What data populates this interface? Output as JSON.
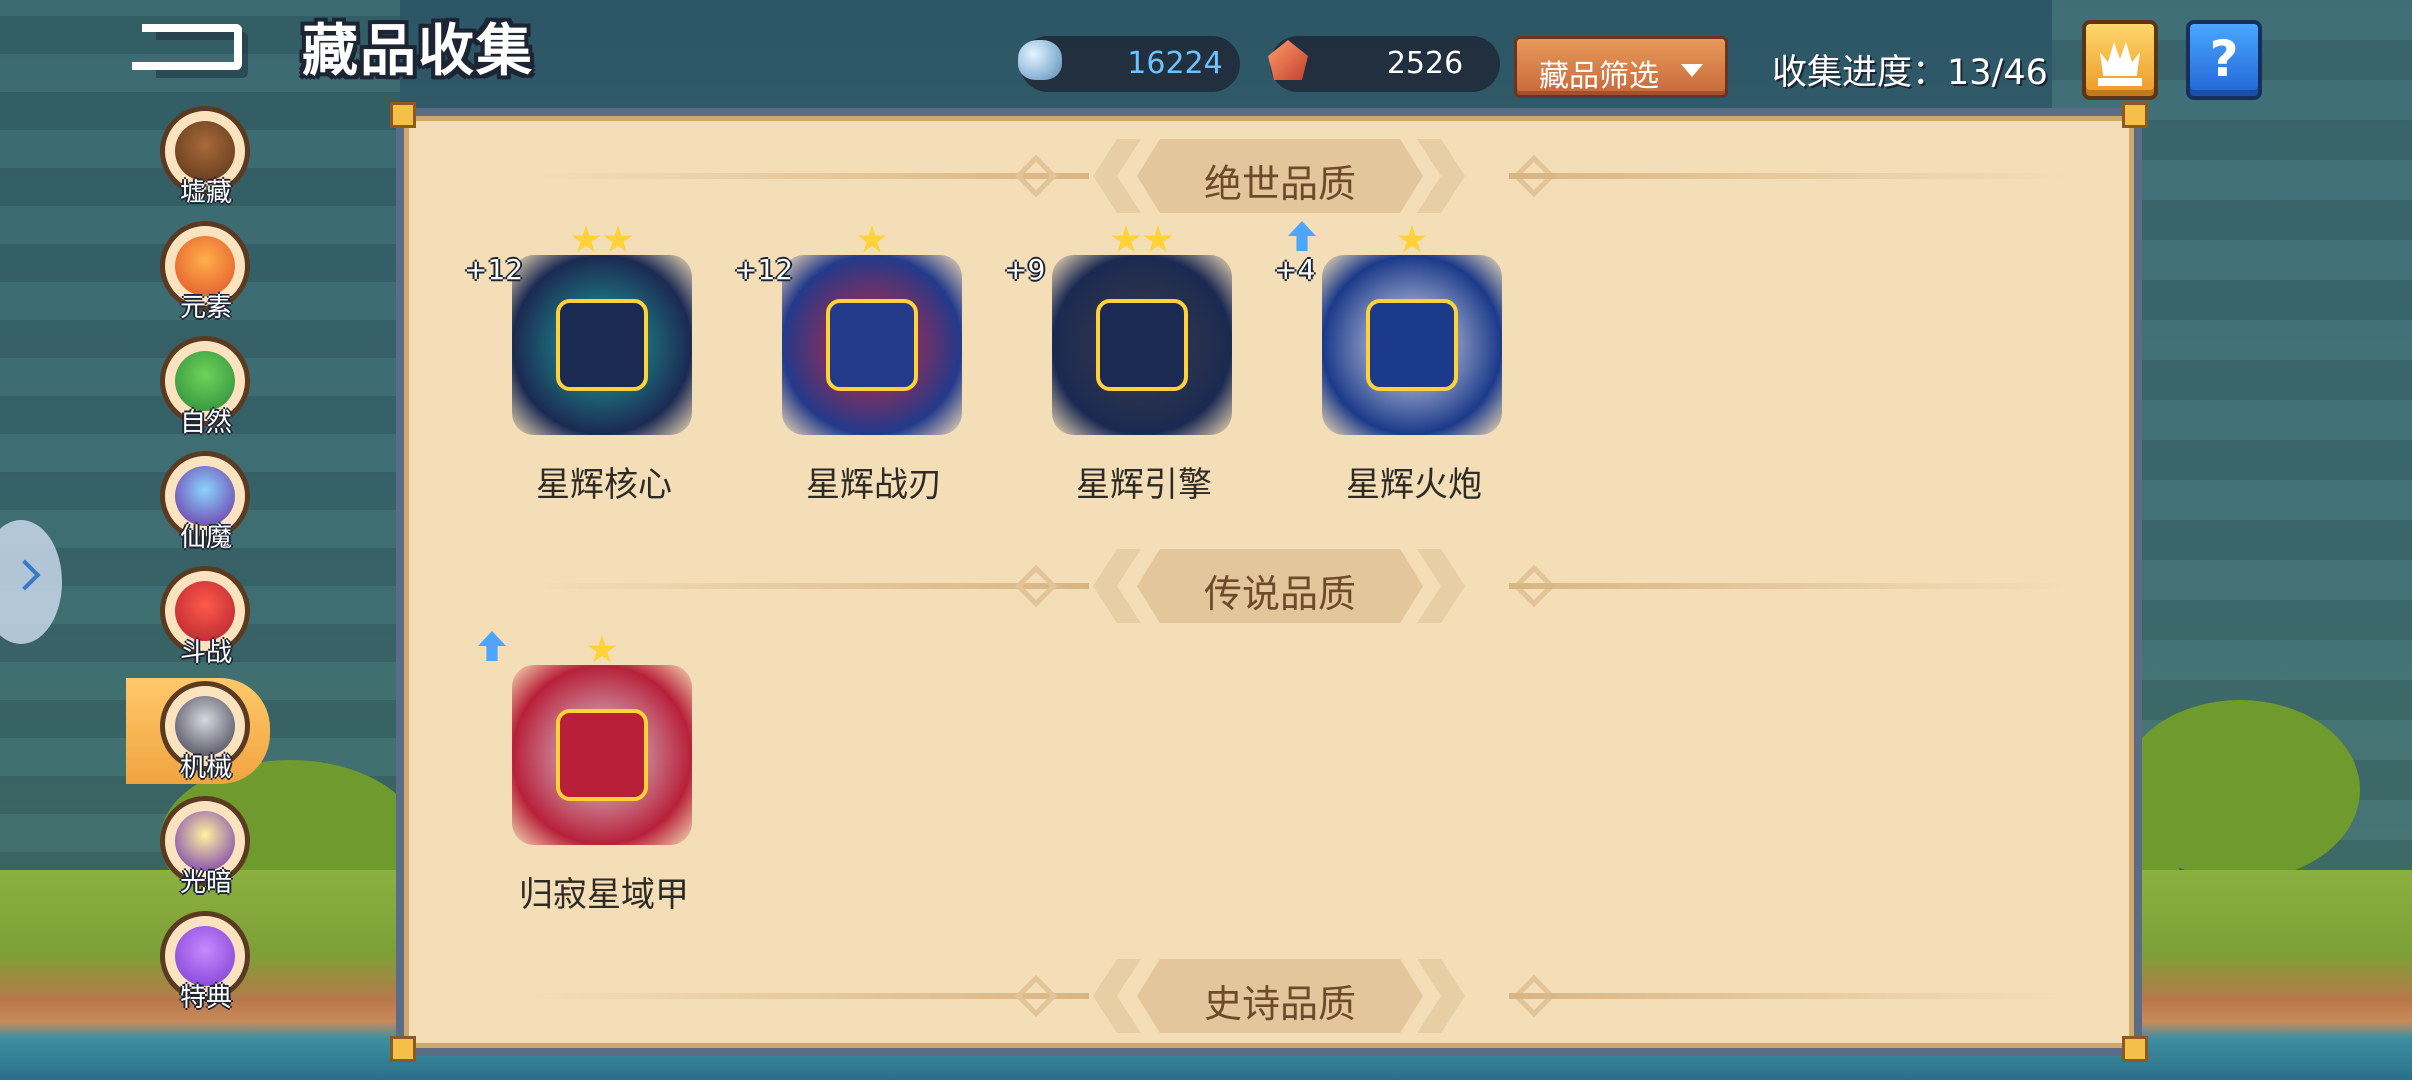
{
  "header": {
    "title": "藏品收集",
    "gems": "16224",
    "crystals": "2526",
    "filter_label": "藏品筛选",
    "progress": "收集进度：13/46"
  },
  "sidebar": {
    "items": [
      {
        "label": "墟藏",
        "icon": "treasure-chest-icon"
      },
      {
        "label": "元素",
        "icon": "fire-orb-icon"
      },
      {
        "label": "自然",
        "icon": "tree-icon"
      },
      {
        "label": "仙魔",
        "icon": "demon-crystal-icon"
      },
      {
        "label": "斗战",
        "icon": "battle-orb-icon"
      },
      {
        "label": "机械",
        "icon": "mech-armor-icon"
      },
      {
        "label": "光暗",
        "icon": "light-dark-icon"
      },
      {
        "label": "特典",
        "icon": "special-star-icon"
      }
    ],
    "active_index": 5
  },
  "sections": [
    {
      "title": "绝世品质",
      "items": [
        {
          "name": "星辉核心",
          "level": "+12",
          "stars": 2,
          "upgradable": false,
          "colors": [
            "#1fa89e",
            "#1b2a52"
          ]
        },
        {
          "name": "星辉战刃",
          "level": "+12",
          "stars": 1,
          "upgradable": false,
          "colors": [
            "#d0253a",
            "#233a8a"
          ]
        },
        {
          "name": "星辉引擎",
          "level": "+9",
          "stars": 2,
          "upgradable": false,
          "colors": [
            "#3a3a46",
            "#1b2a52"
          ]
        },
        {
          "name": "星辉火炮",
          "level": "+4",
          "stars": 1,
          "upgradable": true,
          "colors": [
            "#e8e8f2",
            "#1b3a8a"
          ]
        }
      ]
    },
    {
      "title": "传说品质",
      "items": [
        {
          "name": "归寂星域甲",
          "level": "",
          "stars": 1,
          "upgradable": true,
          "colors": [
            "#d9d9e2",
            "#b8203a"
          ]
        }
      ]
    },
    {
      "title": "史诗品质",
      "items": []
    }
  ]
}
